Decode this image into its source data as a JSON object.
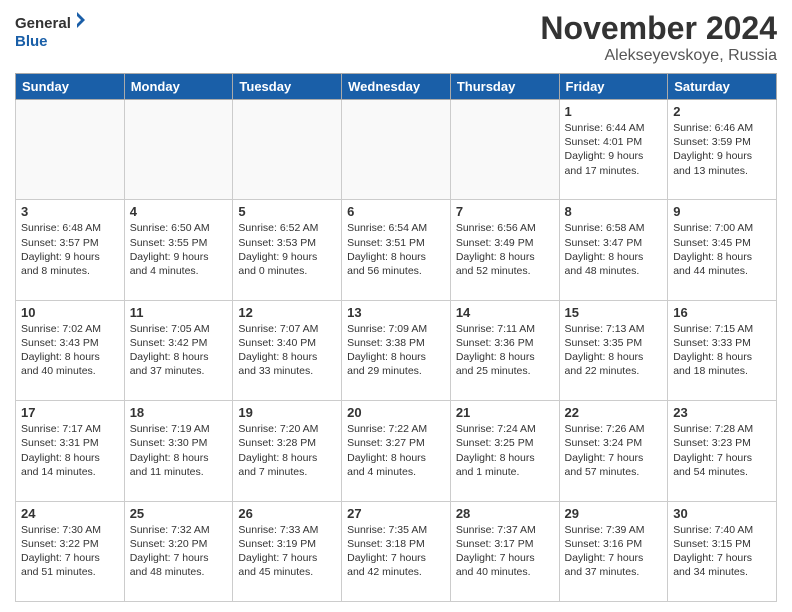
{
  "header": {
    "logo_line1": "General",
    "logo_line2": "Blue",
    "title": "November 2024",
    "subtitle": "Alekseyevskoye, Russia"
  },
  "weekdays": [
    "Sunday",
    "Monday",
    "Tuesday",
    "Wednesday",
    "Thursday",
    "Friday",
    "Saturday"
  ],
  "weeks": [
    [
      {
        "day": "",
        "info": ""
      },
      {
        "day": "",
        "info": ""
      },
      {
        "day": "",
        "info": ""
      },
      {
        "day": "",
        "info": ""
      },
      {
        "day": "",
        "info": ""
      },
      {
        "day": "1",
        "info": "Sunrise: 6:44 AM\nSunset: 4:01 PM\nDaylight: 9 hours and 17 minutes."
      },
      {
        "day": "2",
        "info": "Sunrise: 6:46 AM\nSunset: 3:59 PM\nDaylight: 9 hours and 13 minutes."
      }
    ],
    [
      {
        "day": "3",
        "info": "Sunrise: 6:48 AM\nSunset: 3:57 PM\nDaylight: 9 hours and 8 minutes."
      },
      {
        "day": "4",
        "info": "Sunrise: 6:50 AM\nSunset: 3:55 PM\nDaylight: 9 hours and 4 minutes."
      },
      {
        "day": "5",
        "info": "Sunrise: 6:52 AM\nSunset: 3:53 PM\nDaylight: 9 hours and 0 minutes."
      },
      {
        "day": "6",
        "info": "Sunrise: 6:54 AM\nSunset: 3:51 PM\nDaylight: 8 hours and 56 minutes."
      },
      {
        "day": "7",
        "info": "Sunrise: 6:56 AM\nSunset: 3:49 PM\nDaylight: 8 hours and 52 minutes."
      },
      {
        "day": "8",
        "info": "Sunrise: 6:58 AM\nSunset: 3:47 PM\nDaylight: 8 hours and 48 minutes."
      },
      {
        "day": "9",
        "info": "Sunrise: 7:00 AM\nSunset: 3:45 PM\nDaylight: 8 hours and 44 minutes."
      }
    ],
    [
      {
        "day": "10",
        "info": "Sunrise: 7:02 AM\nSunset: 3:43 PM\nDaylight: 8 hours and 40 minutes."
      },
      {
        "day": "11",
        "info": "Sunrise: 7:05 AM\nSunset: 3:42 PM\nDaylight: 8 hours and 37 minutes."
      },
      {
        "day": "12",
        "info": "Sunrise: 7:07 AM\nSunset: 3:40 PM\nDaylight: 8 hours and 33 minutes."
      },
      {
        "day": "13",
        "info": "Sunrise: 7:09 AM\nSunset: 3:38 PM\nDaylight: 8 hours and 29 minutes."
      },
      {
        "day": "14",
        "info": "Sunrise: 7:11 AM\nSunset: 3:36 PM\nDaylight: 8 hours and 25 minutes."
      },
      {
        "day": "15",
        "info": "Sunrise: 7:13 AM\nSunset: 3:35 PM\nDaylight: 8 hours and 22 minutes."
      },
      {
        "day": "16",
        "info": "Sunrise: 7:15 AM\nSunset: 3:33 PM\nDaylight: 8 hours and 18 minutes."
      }
    ],
    [
      {
        "day": "17",
        "info": "Sunrise: 7:17 AM\nSunset: 3:31 PM\nDaylight: 8 hours and 14 minutes."
      },
      {
        "day": "18",
        "info": "Sunrise: 7:19 AM\nSunset: 3:30 PM\nDaylight: 8 hours and 11 minutes."
      },
      {
        "day": "19",
        "info": "Sunrise: 7:20 AM\nSunset: 3:28 PM\nDaylight: 8 hours and 7 minutes."
      },
      {
        "day": "20",
        "info": "Sunrise: 7:22 AM\nSunset: 3:27 PM\nDaylight: 8 hours and 4 minutes."
      },
      {
        "day": "21",
        "info": "Sunrise: 7:24 AM\nSunset: 3:25 PM\nDaylight: 8 hours and 1 minute."
      },
      {
        "day": "22",
        "info": "Sunrise: 7:26 AM\nSunset: 3:24 PM\nDaylight: 7 hours and 57 minutes."
      },
      {
        "day": "23",
        "info": "Sunrise: 7:28 AM\nSunset: 3:23 PM\nDaylight: 7 hours and 54 minutes."
      }
    ],
    [
      {
        "day": "24",
        "info": "Sunrise: 7:30 AM\nSunset: 3:22 PM\nDaylight: 7 hours and 51 minutes."
      },
      {
        "day": "25",
        "info": "Sunrise: 7:32 AM\nSunset: 3:20 PM\nDaylight: 7 hours and 48 minutes."
      },
      {
        "day": "26",
        "info": "Sunrise: 7:33 AM\nSunset: 3:19 PM\nDaylight: 7 hours and 45 minutes."
      },
      {
        "day": "27",
        "info": "Sunrise: 7:35 AM\nSunset: 3:18 PM\nDaylight: 7 hours and 42 minutes."
      },
      {
        "day": "28",
        "info": "Sunrise: 7:37 AM\nSunset: 3:17 PM\nDaylight: 7 hours and 40 minutes."
      },
      {
        "day": "29",
        "info": "Sunrise: 7:39 AM\nSunset: 3:16 PM\nDaylight: 7 hours and 37 minutes."
      },
      {
        "day": "30",
        "info": "Sunrise: 7:40 AM\nSunset: 3:15 PM\nDaylight: 7 hours and 34 minutes."
      }
    ]
  ]
}
